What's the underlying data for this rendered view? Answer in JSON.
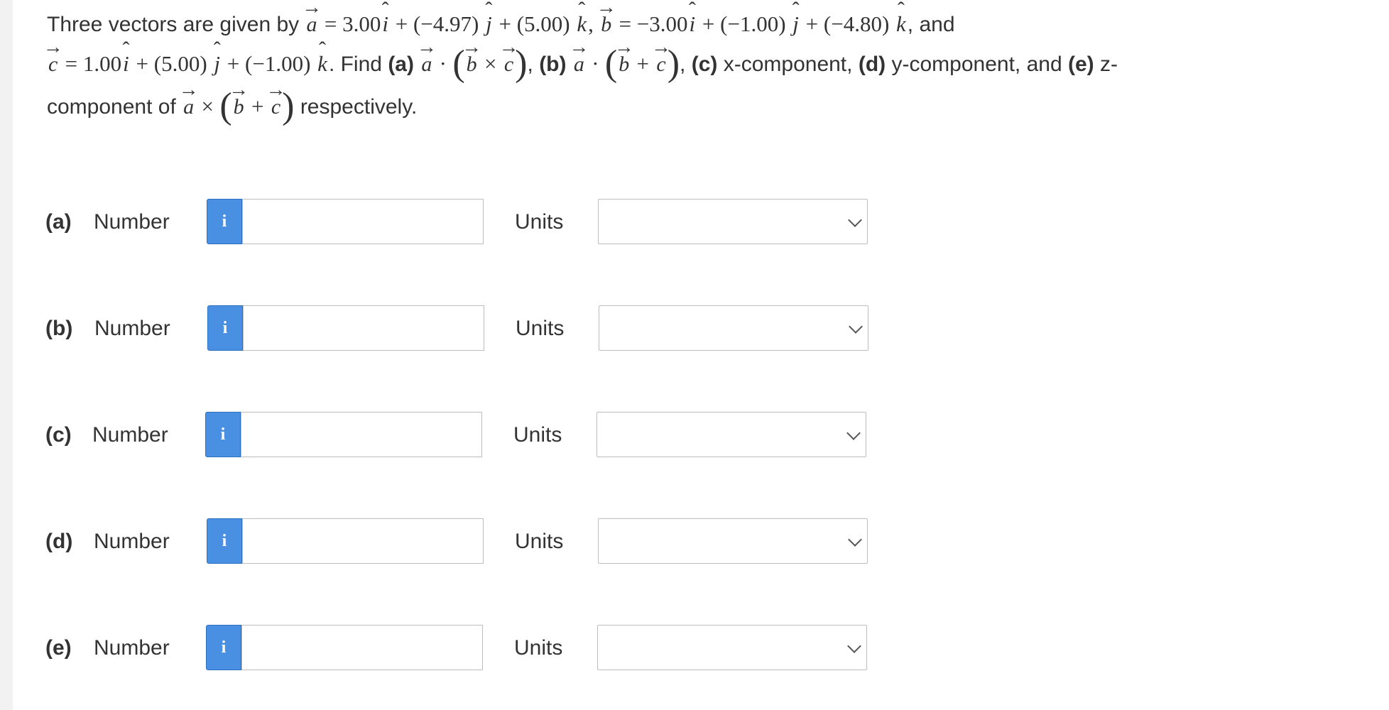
{
  "problem": {
    "t1": "Three vectors are given by",
    "a_sym": "a",
    "a_eq": "= 3.00",
    "a_i": "i",
    "a_j_coef": " + (−4.97) ",
    "a_j": "j",
    "a_k_coef": " + (5.00) ",
    "a_k": "k",
    "sep1": ",",
    "b_sym": "b",
    "b_eq": "= −3.00",
    "b_i": "i",
    "b_j_coef": " + (−1.00) ",
    "b_j": "j",
    "b_k_coef": " + (−4.80) ",
    "b_k": "k",
    "and": ", and",
    "c_sym": "c",
    "c_eq": "= 1.00",
    "c_i": "i",
    "c_j_coef": " + (5.00) ",
    "c_j": "j",
    "c_k_coef": " + (−1.00) ",
    "c_k": "k",
    "find": ". Find",
    "pa": "(a)",
    "pb": "(b)",
    "pc": "(c)",
    "pd": "(d)",
    "pe": "(e)",
    "x_comp": "x-component,",
    "y_comp": "y-component, and",
    "z_comp": "z-",
    "component_of": "component of",
    "respectively": "respectively.",
    "dot": "·",
    "cross": "×",
    "plus": "+",
    "lparen": "(",
    "rparen": ")",
    "comma": ","
  },
  "rows": [
    {
      "letter": "(a)",
      "number_label": "Number",
      "info": "i",
      "value": "",
      "units_label": "Units",
      "units_value": ""
    },
    {
      "letter": "(b)",
      "number_label": "Number",
      "info": "i",
      "value": "",
      "units_label": "Units",
      "units_value": ""
    },
    {
      "letter": "(c)",
      "number_label": "Number",
      "info": "i",
      "value": "",
      "units_label": "Units",
      "units_value": ""
    },
    {
      "letter": "(d)",
      "number_label": "Number",
      "info": "i",
      "value": "",
      "units_label": "Units",
      "units_value": ""
    },
    {
      "letter": "(e)",
      "number_label": "Number",
      "info": "i",
      "value": "",
      "units_label": "Units",
      "units_value": ""
    }
  ],
  "colors": {
    "info_button": "#4a90e2",
    "background": "#f2f2f2",
    "panel": "#ffffff"
  },
  "icons": {
    "info": "info-icon",
    "dropdown": "chevron-down-icon"
  }
}
